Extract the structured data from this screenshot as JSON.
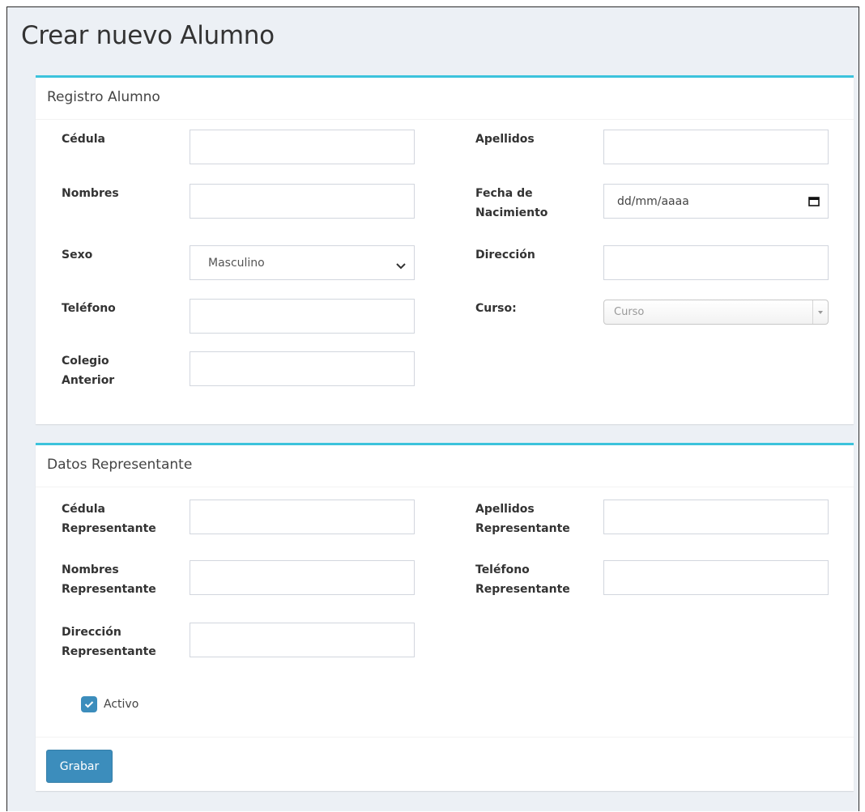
{
  "page": {
    "title": "Crear nuevo Alumno"
  },
  "registro": {
    "title": "Registro Alumno",
    "cedula_label": "Cédula",
    "cedula_value": "",
    "apellidos_label": "Apellidos",
    "apellidos_value": "",
    "nombres_label": "Nombres",
    "nombres_value": "",
    "fecha_label": "Fecha de Nacimiento",
    "fecha_placeholder": "dd/mm/aaaa",
    "sexo_label": "Sexo",
    "sexo_value": "Masculino",
    "direccion_label": "Dirección",
    "direccion_value": "",
    "telefono_label": "Teléfono",
    "telefono_value": "",
    "curso_label": "Curso:",
    "curso_placeholder": "Curso",
    "colegio_label": "Colegio Anterior",
    "colegio_value": ""
  },
  "representante": {
    "title": "Datos Representante",
    "cedula_label": "Cédula Representante",
    "cedula_value": "",
    "apellidos_label": "Apellidos Representante",
    "apellidos_value": "",
    "nombres_label": "Nombres Representante",
    "nombres_value": "",
    "telefono_label": "Teléfono Representante",
    "telefono_value": "",
    "direccion_label": "Dirección Representante",
    "direccion_value": ""
  },
  "activo": {
    "label": "Activo",
    "checked": true
  },
  "actions": {
    "save_label": "Grabar"
  },
  "colors": {
    "accent": "#3c8dbc",
    "box_border": "#3cc3dc",
    "background": "#ecf0f5"
  },
  "icons": {
    "calendar": "calendar-icon",
    "dropdown": "chevron-down-icon",
    "check": "check-icon"
  }
}
